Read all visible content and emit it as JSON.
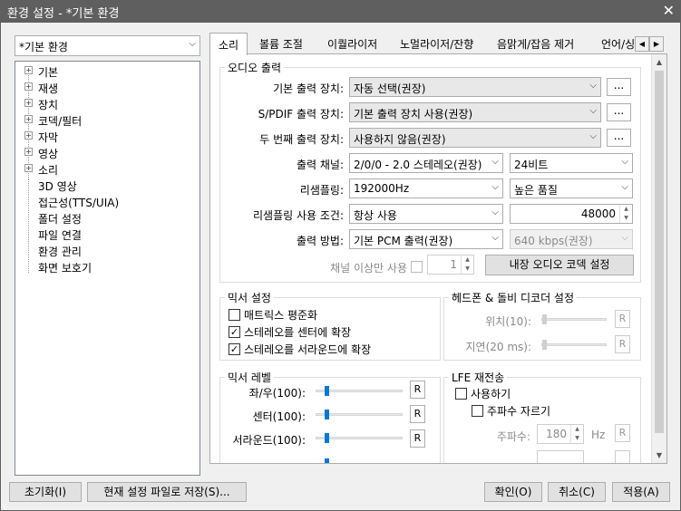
{
  "window": {
    "title": "환경 설정 - *기본 환경",
    "close_glyph": "✕"
  },
  "preset": {
    "value": "*기본 환경"
  },
  "tree": {
    "items": [
      {
        "label": "기본",
        "expandable": true
      },
      {
        "label": "재생",
        "expandable": true
      },
      {
        "label": "장치",
        "expandable": true
      },
      {
        "label": "코덱/필터",
        "expandable": true
      },
      {
        "label": "자막",
        "expandable": true
      },
      {
        "label": "영상",
        "expandable": true
      },
      {
        "label": "소리",
        "expandable": true
      },
      {
        "label": "3D 영상",
        "expandable": false
      },
      {
        "label": "접근성(TTS/UIA)",
        "expandable": false
      },
      {
        "label": "폴더 설정",
        "expandable": false
      },
      {
        "label": "파일 연결",
        "expandable": false
      },
      {
        "label": "환경 관리",
        "expandable": false
      },
      {
        "label": "화면 보호기",
        "expandable": false
      }
    ]
  },
  "tabs": [
    "소리",
    "볼륨 조절",
    "이퀄라이저",
    "노멀라이저/잔향",
    "음맑게/잡음 제거",
    "언어/싱"
  ],
  "audio_output": {
    "title": "오디오 출력",
    "default_device_label": "기본 출력 장치:",
    "default_device_value": "자동 선택(권장)",
    "spdif_label": "S/PDIF 출력 장치:",
    "spdif_value": "기본 출력 장치 사용(권장)",
    "second_label": "두 번째 출력 장치:",
    "second_value": "사용하지 않음(권장)",
    "dots": "...",
    "channel_label": "출력 채널:",
    "channel_value": "2/0/0 - 2.0 스테레오(권장)",
    "bits_value": "24비트",
    "resample_label": "리샘플링:",
    "resample_value": "192000Hz",
    "quality_value": "높은 품질",
    "resample_cond_label": "리샘플링 사용 조건:",
    "resample_cond_value": "항상 사용",
    "resample_cond_num": "48000",
    "method_label": "출력 방법:",
    "method_value": "기본 PCM 출력(권장)",
    "bitrate_value": "640 kbps(권장)",
    "channel_min_label": "채널 이상만 사용",
    "channel_min_value": "1",
    "codec_button": "내장 오디오 코덱 설정"
  },
  "mixer_settings": {
    "title": "믹서 설정",
    "items": [
      {
        "label": "매트릭스 평준화",
        "checked": false
      },
      {
        "label": "스테레오를 센터에 확장",
        "checked": true
      },
      {
        "label": "스테레오를 서라운드에 확장",
        "checked": true
      }
    ]
  },
  "headphone": {
    "title": "헤드폰 & 돌비 디코더 설정",
    "pos_label": "위치(10):",
    "delay_label": "지연(20 ms):",
    "reset": "R"
  },
  "mixer_level": {
    "title": "믹서 레벨",
    "rows": [
      {
        "label": "좌/우(100):",
        "level": 0.1
      },
      {
        "label": "센터(100):",
        "level": 0.1
      },
      {
        "label": "서라운드(100):",
        "level": 0.1
      }
    ],
    "reset": "R"
  },
  "lfe": {
    "title": "LFE 재전송",
    "enable_label": "사용하기",
    "cutoff_label": "주파수 자르기",
    "freq_label": "주파수:",
    "freq_value": "180",
    "freq_unit": "Hz",
    "reset": "R"
  },
  "buttons": {
    "reset": "초기화(I)",
    "save_file": "현재 설정 파일로 저장(S)...",
    "ok": "확인(O)",
    "cancel": "취소(C)",
    "apply": "적용(A)"
  }
}
